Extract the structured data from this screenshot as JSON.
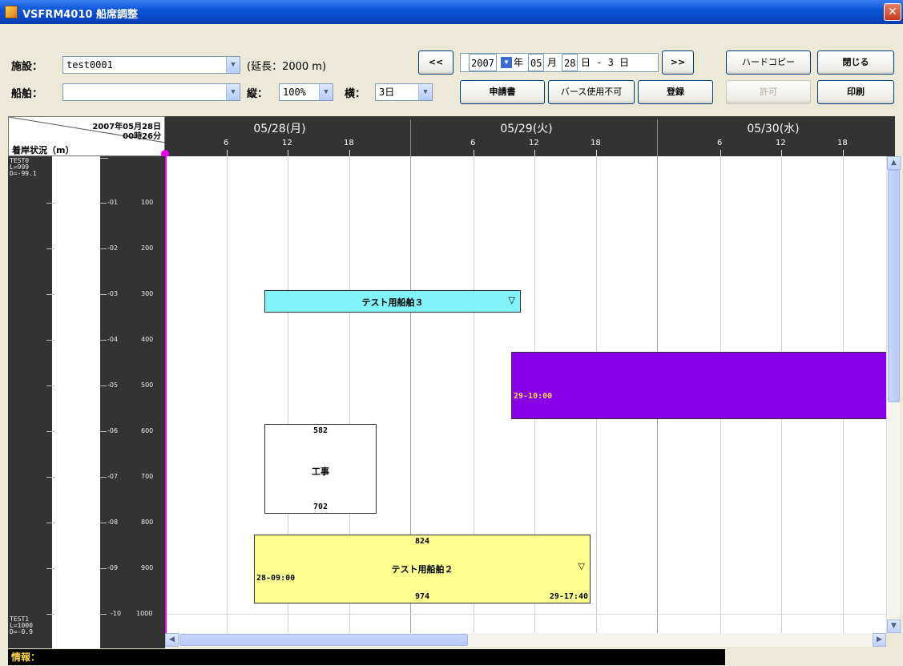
{
  "window": {
    "title": "VSFRM4010 船席調整",
    "close_glyph": "✕"
  },
  "toolbar": {
    "facility_label": "施設：",
    "facility_value": "test0001",
    "length_label": "(延長：2000 m)",
    "ship_label": "船舶：",
    "ship_value": "",
    "vert_label": "縦：",
    "vert_value": "100%",
    "horiz_label": "横：",
    "horiz_value": "3日",
    "prev_label": "<<",
    "next_label": ">>",
    "year_value": "2007",
    "year_unit": "年",
    "month_value": "05",
    "month_unit": "月",
    "day_value": "28",
    "day_suffix": "日 - 3 日",
    "hardcopy_label": "ハードコピー",
    "close_label": "閉じる",
    "application_label": "申請書",
    "berth_unavailable_label": "バース使用不可",
    "register_label": "登録",
    "permit_label": "許可",
    "print_label": "印刷"
  },
  "schedule": {
    "corner_date": "2007年05月28日",
    "corner_time": "00時26分",
    "corner_caption": "着岸状況（m）",
    "days": [
      {
        "label": "05/28(月)"
      },
      {
        "label": "05/29(火)"
      },
      {
        "label": "05/30(水)"
      }
    ],
    "hour_labels": [
      "6",
      "12",
      "18"
    ],
    "berths": [
      {
        "label": "TEST0\nL=999\nD=-99.1"
      },
      {
        "label": "TEST1\nL=1000\nD=-0.9"
      }
    ],
    "ruler": [
      {
        "code": "-01",
        "m": "100"
      },
      {
        "code": "-02",
        "m": "200"
      },
      {
        "code": "-03",
        "m": "300"
      },
      {
        "code": "-04",
        "m": "400"
      },
      {
        "code": "-05",
        "m": "500"
      },
      {
        "code": "-06",
        "m": "600"
      },
      {
        "code": "-07",
        "m": "700"
      },
      {
        "code": "-08",
        "m": "800"
      },
      {
        "code": "-09",
        "m": "900"
      },
      {
        "code": "-10",
        "m": "1000"
      }
    ],
    "blocks": {
      "ship3": {
        "name": "テスト用船舶３",
        "marker": "▽",
        "color": "#80f4f8"
      },
      "purple": {
        "start_text": "29-10:00",
        "color": "#8800e8"
      },
      "construction": {
        "name": "工事",
        "from": "582",
        "to": "702",
        "color": "#ffffff"
      },
      "ship2": {
        "name": "テスト用船舶２",
        "marker": "▽",
        "from": "824",
        "to": "974",
        "start_text": "28-09:00",
        "end_text": "29-17:40",
        "color": "#ffff90"
      }
    }
  },
  "status": {
    "info_label": "情報："
  }
}
